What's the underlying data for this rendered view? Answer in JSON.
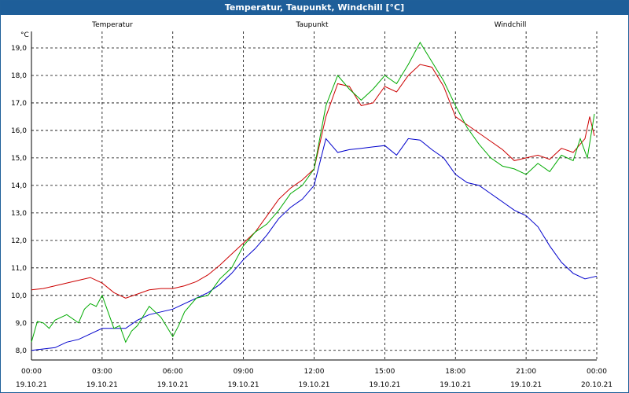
{
  "window": {
    "title": "Temperatur, Taupunkt, Windchill [°C]"
  },
  "chart_data": {
    "type": "line",
    "title": "Temperatur, Taupunkt, Windchill [°C]",
    "ylabel": "°C",
    "ylim": [
      7.65,
      19.6
    ],
    "xlim": [
      0,
      24
    ],
    "grid": true,
    "legend_placement": "top",
    "y_ticks": [
      "8,0",
      "9,0",
      "10,0",
      "11,0",
      "12,0",
      "13,0",
      "14,0",
      "15,0",
      "16,0",
      "17,0",
      "18,0",
      "19,0"
    ],
    "x_ticks": [
      {
        "time": "00:00",
        "date": "19.10.21"
      },
      {
        "time": "03:00",
        "date": "19.10.21"
      },
      {
        "time": "06:00",
        "date": "19.10.21"
      },
      {
        "time": "09:00",
        "date": "19.10.21"
      },
      {
        "time": "12:00",
        "date": "19.10.21"
      },
      {
        "time": "15:00",
        "date": "19.10.21"
      },
      {
        "time": "18:00",
        "date": "19.10.21"
      },
      {
        "time": "21:00",
        "date": "19.10.21"
      },
      {
        "time": "00:00",
        "date": "20.10.21"
      }
    ],
    "series": [
      {
        "name": "Temperatur",
        "color": "#cc0000",
        "x": [
          0,
          0.5,
          1,
          1.5,
          2,
          2.5,
          3,
          3.5,
          4,
          4.5,
          5,
          5.5,
          6,
          6.5,
          7,
          7.5,
          8,
          8.5,
          9,
          9.5,
          10,
          10.5,
          11,
          11.5,
          12,
          12.5,
          13,
          13.5,
          14,
          14.5,
          15,
          15.5,
          16,
          16.5,
          17,
          17.5,
          18,
          18.5,
          19,
          19.5,
          20,
          20.5,
          21,
          21.5,
          22,
          22.5,
          23,
          23.5,
          23.9
        ],
        "y": [
          10.2,
          10.25,
          10.35,
          10.45,
          10.55,
          10.65,
          10.45,
          10.1,
          9.9,
          10.05,
          10.2,
          10.25,
          10.25,
          10.35,
          10.5,
          10.75,
          11.1,
          11.5,
          11.9,
          12.3,
          12.9,
          13.5,
          13.9,
          14.2,
          14.6,
          16.5,
          17.7,
          17.6,
          16.9,
          17.0,
          17.6,
          17.4,
          18.0,
          18.4,
          18.3,
          17.6,
          16.5,
          16.2,
          15.9,
          15.6,
          15.3,
          14.9,
          15.0,
          15.1,
          14.95,
          15.35,
          15.2,
          15.7,
          15.8
        ],
        "detail": "end ramps to 16.5 at 23.7h"
      },
      {
        "name": "Taupunkt",
        "color": "#0000cc",
        "x": [
          0,
          0.5,
          1,
          1.5,
          2,
          2.5,
          3,
          3.5,
          4,
          4.5,
          5,
          5.5,
          6,
          6.5,
          7,
          7.5,
          8,
          8.5,
          9,
          9.5,
          10,
          10.5,
          11,
          11.5,
          12,
          12.5,
          13,
          13.5,
          14,
          14.5,
          15,
          15.5,
          16,
          16.5,
          17,
          17.5,
          18,
          18.5,
          19,
          19.5,
          20,
          20.5,
          21,
          21.5,
          22,
          22.5,
          23,
          23.5,
          24
        ],
        "y": [
          8.0,
          8.05,
          8.1,
          8.3,
          8.4,
          8.6,
          8.8,
          8.8,
          8.8,
          9.1,
          9.3,
          9.4,
          9.5,
          9.7,
          9.9,
          10.1,
          10.4,
          10.8,
          11.3,
          11.7,
          12.2,
          12.8,
          13.2,
          13.5,
          14.0,
          15.7,
          15.2,
          15.3,
          15.35,
          15.4,
          15.45,
          15.1,
          15.7,
          15.65,
          15.3,
          15.0,
          14.4,
          14.1,
          14.0,
          13.7,
          13.4,
          13.1,
          12.9,
          12.5,
          11.8,
          11.2,
          10.8,
          10.6,
          10.7
        ]
      },
      {
        "name": "Windchill",
        "color": "#00aa00",
        "x": [
          0,
          0.25,
          0.5,
          0.75,
          1,
          1.5,
          2,
          2.25,
          2.5,
          2.75,
          3,
          3.25,
          3.5,
          3.75,
          4,
          4.25,
          4.5,
          5,
          5.5,
          6,
          6.25,
          6.5,
          7,
          7.5,
          8,
          8.5,
          9,
          9.5,
          10,
          10.5,
          11,
          11.5,
          12,
          12.5,
          13,
          13.5,
          14,
          14.5,
          15,
          15.5,
          16,
          16.5,
          17,
          17.5,
          18,
          18.5,
          19,
          19.5,
          20,
          20.5,
          21,
          21.5,
          22,
          22.5,
          23,
          23.3,
          23.6,
          23.9
        ],
        "y": [
          8.3,
          9.05,
          9.0,
          8.8,
          9.1,
          9.3,
          9.0,
          9.5,
          9.7,
          9.6,
          10.0,
          9.4,
          8.8,
          8.9,
          8.3,
          8.7,
          8.9,
          9.6,
          9.2,
          8.5,
          8.9,
          9.4,
          9.9,
          10.0,
          10.6,
          11.0,
          11.8,
          12.3,
          12.6,
          13.1,
          13.7,
          14.0,
          14.6,
          16.9,
          18.0,
          17.5,
          17.1,
          17.5,
          18.0,
          17.7,
          18.4,
          19.2,
          18.5,
          17.8,
          16.9,
          16.1,
          15.5,
          15.0,
          14.7,
          14.6,
          14.4,
          14.8,
          14.5,
          15.1,
          14.9,
          15.7,
          15.0,
          16.6
        ]
      }
    ]
  }
}
